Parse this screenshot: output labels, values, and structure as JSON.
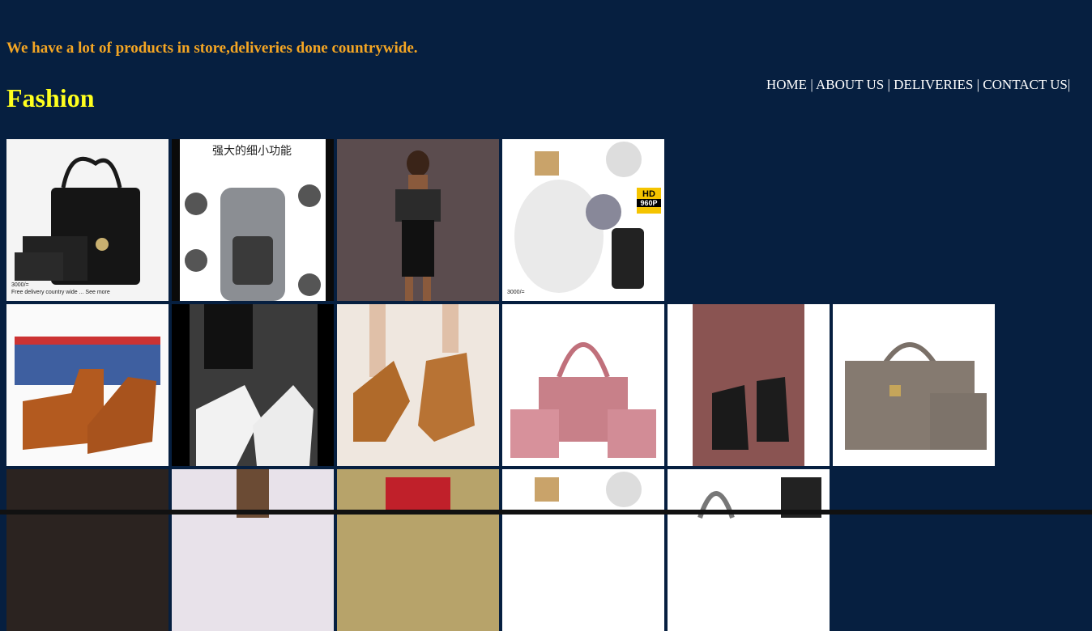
{
  "header": {
    "tagline": "We have a lot of products in store,deliveries done countrywide.",
    "brand": "Fashion"
  },
  "nav": {
    "items": [
      "HOME",
      "ABOUT US",
      "DELIVERIES",
      "CONTACT US"
    ],
    "separator": "|"
  },
  "products": {
    "tile1_caption_line1": "3000/=",
    "tile1_caption_line2": "Free delivery country wide ... See more",
    "tile2_heading": "强大的细小功能",
    "tile4_badge": "HD",
    "tile4_badge_sub": "960P",
    "tile4_caption": "3000/="
  },
  "colors": {
    "background": "#061f40",
    "tagline": "#f5a623",
    "brand": "#ffff1e",
    "nav": "#ffffff"
  }
}
